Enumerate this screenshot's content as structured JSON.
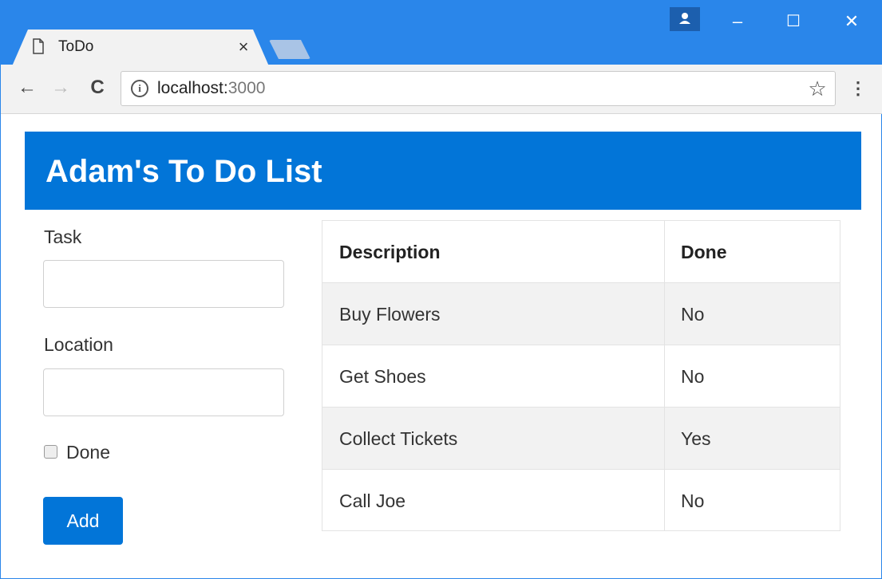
{
  "browser": {
    "tab_title": "ToDo",
    "tab_close": "×",
    "url_host": "localhost:",
    "url_port": "3000",
    "nav": {
      "back": "←",
      "forward": "→",
      "reload": "C"
    },
    "window": {
      "minimize": "–",
      "maximize": "☐",
      "close": "✕"
    },
    "star": "☆",
    "menu": "⋮",
    "info": "i"
  },
  "page": {
    "title": "Adam's To Do List",
    "form": {
      "task_label": "Task",
      "task_value": "",
      "location_label": "Location",
      "location_value": "",
      "done_label": "Done",
      "done_checked": false,
      "add_label": "Add"
    },
    "table": {
      "headers": [
        "Description",
        "Done"
      ],
      "rows": [
        {
          "description": "Buy Flowers",
          "done": "No"
        },
        {
          "description": "Get Shoes",
          "done": "No"
        },
        {
          "description": "Collect Tickets",
          "done": "Yes"
        },
        {
          "description": "Call Joe",
          "done": "No"
        }
      ]
    }
  },
  "colors": {
    "chrome_blue": "#2a86ea",
    "header_blue": "#0275d8",
    "stripe": "#f2f2f2"
  }
}
